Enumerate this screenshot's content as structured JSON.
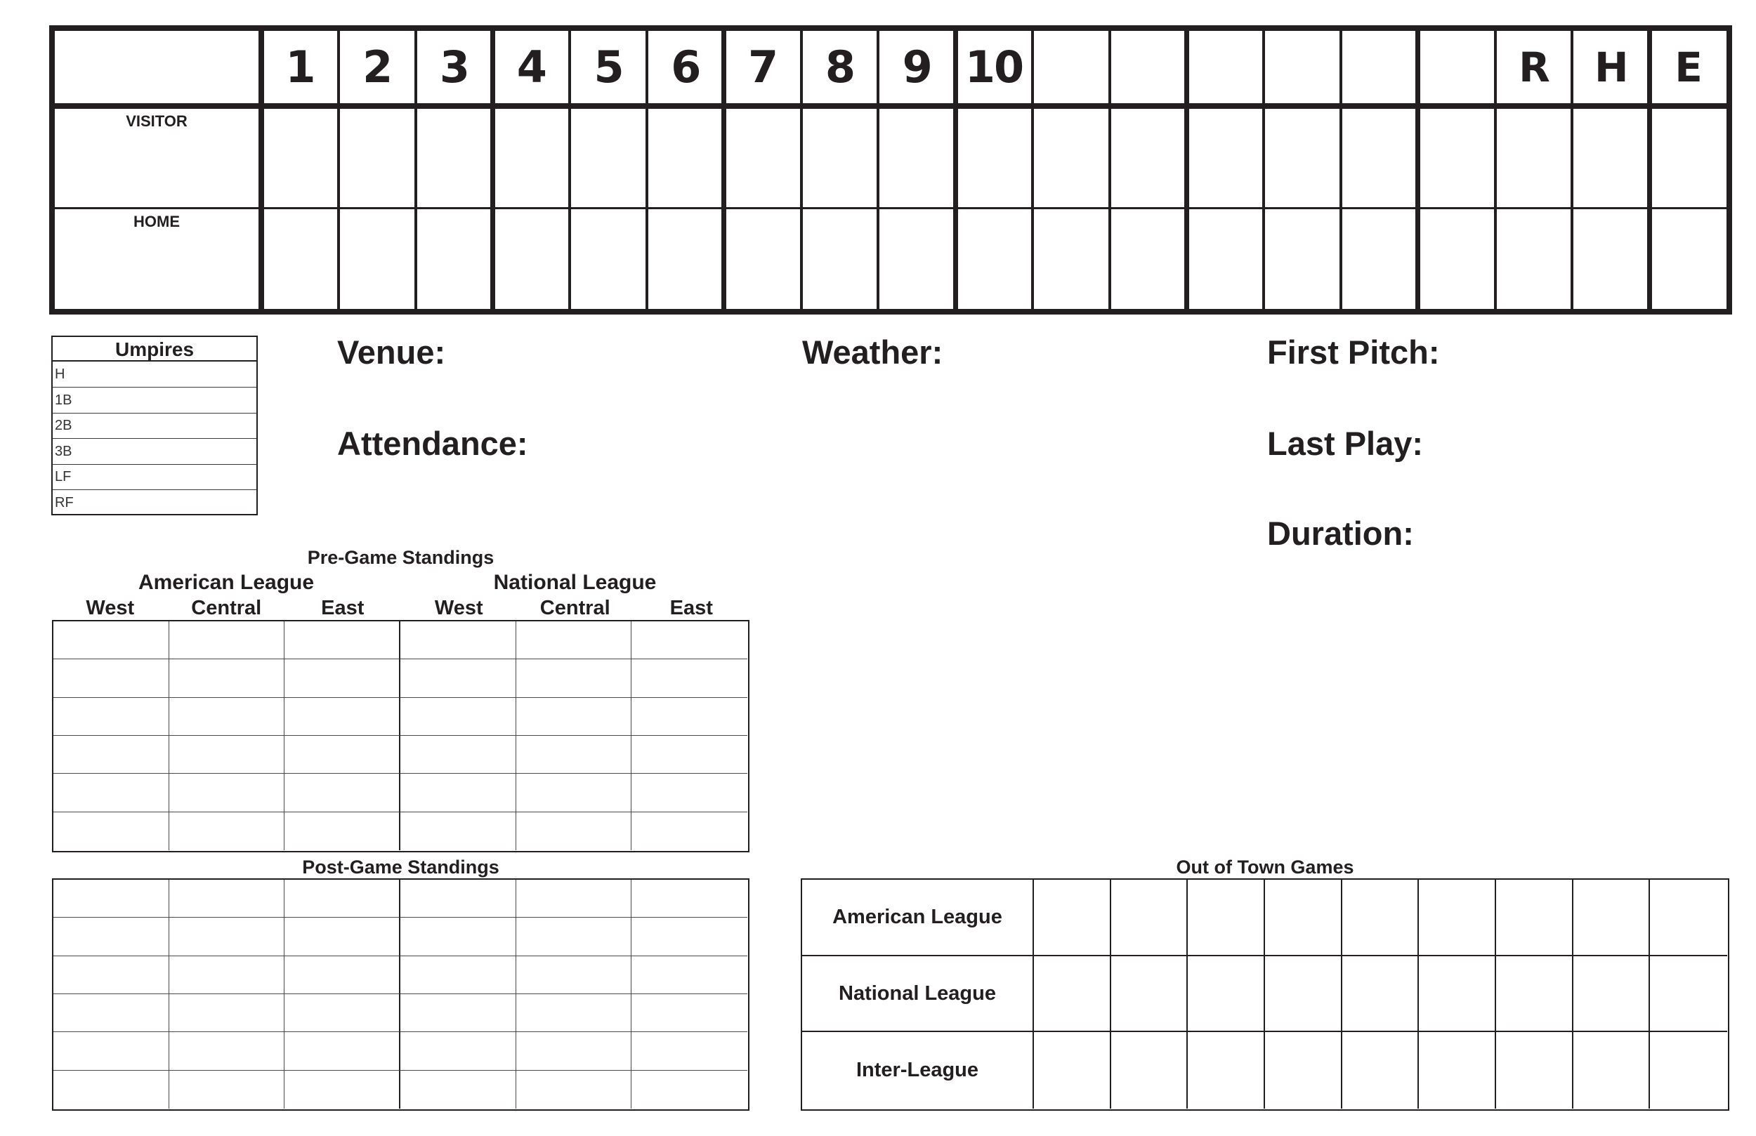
{
  "line_score": {
    "innings": [
      "1",
      "2",
      "3",
      "4",
      "5",
      "6",
      "7",
      "8",
      "9",
      "10",
      "",
      "",
      "",
      "",
      "",
      ""
    ],
    "totals": [
      "R",
      "H",
      "E"
    ],
    "teams": [
      {
        "label": "VISITOR",
        "innings": [
          "",
          "",
          "",
          "",
          "",
          "",
          "",
          "",
          "",
          "",
          "",
          "",
          "",
          "",
          "",
          ""
        ],
        "totals": [
          "",
          "",
          ""
        ]
      },
      {
        "label": "HOME",
        "innings": [
          "",
          "",
          "",
          "",
          "",
          "",
          "",
          "",
          "",
          "",
          "",
          "",
          "",
          "",
          "",
          ""
        ],
        "totals": [
          "",
          "",
          ""
        ]
      }
    ]
  },
  "umpires": {
    "title": "Umpires",
    "positions": [
      {
        "label": "H",
        "name": ""
      },
      {
        "label": "1B",
        "name": ""
      },
      {
        "label": "2B",
        "name": ""
      },
      {
        "label": "3B",
        "name": ""
      },
      {
        "label": "LF",
        "name": ""
      },
      {
        "label": "RF",
        "name": ""
      }
    ]
  },
  "game_info": {
    "venue": {
      "label": "Venue:",
      "value": ""
    },
    "weather": {
      "label": "Weather:",
      "value": ""
    },
    "first_pitch": {
      "label": "First Pitch:",
      "value": ""
    },
    "attendance": {
      "label": "Attendance:",
      "value": ""
    },
    "last_play": {
      "label": "Last Play:",
      "value": ""
    },
    "duration": {
      "label": "Duration:",
      "value": ""
    }
  },
  "standings": {
    "pre_game_title": "Pre-Game Standings",
    "post_game_title": "Post-Game Standings",
    "leagues": [
      "American League",
      "National League"
    ],
    "divisions": [
      "West",
      "Central",
      "East",
      "West",
      "Central",
      "East"
    ],
    "rows": 6
  },
  "out_of_town": {
    "title": "Out of Town Games",
    "rows": [
      "American League",
      "National League",
      "Inter-League"
    ],
    "columns": 9
  }
}
